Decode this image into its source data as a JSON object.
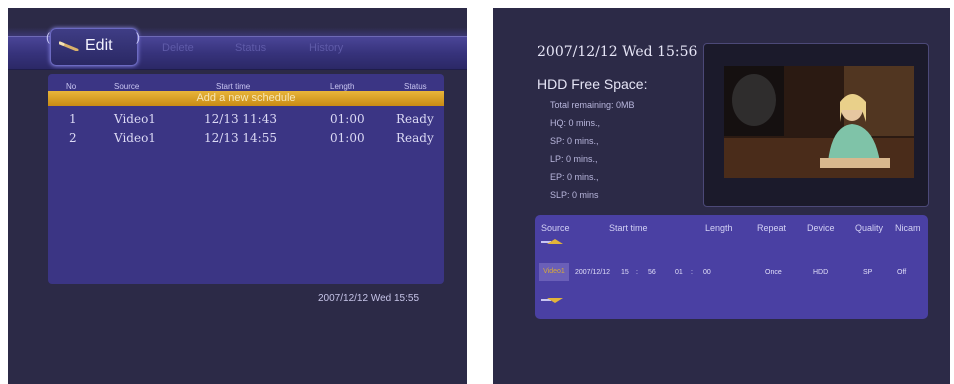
{
  "left": {
    "tabs": {
      "edit": "Edit",
      "delete": "Delete",
      "status": "Status",
      "history": "History"
    },
    "table": {
      "headers": [
        "No",
        "Source",
        "Start time",
        "Length",
        "Status"
      ],
      "add_new": "Add a new schedule",
      "rows": [
        {
          "no": "1",
          "source": "Video1",
          "start": "12/13 11:43",
          "length": "01:00",
          "status": "Ready"
        },
        {
          "no": "2",
          "source": "Video1",
          "start": "12/13 14:55",
          "length": "01:00",
          "status": "Ready"
        }
      ]
    },
    "datetime": "2007/12/12 Wed 15:55"
  },
  "right": {
    "datetime": "2007/12/12 Wed 15:56",
    "hdd_title": "HDD Free Space:",
    "hdd_lines": [
      "Total remaining: 0MB",
      "HQ: 0 mins.,",
      "SP: 0 mins.,",
      "LP: 0 mins.,",
      "EP: 0 mins.,",
      "SLP: 0 mins"
    ],
    "schedule": {
      "headers": [
        "Source",
        "Start time",
        "Length",
        "Repeat",
        "Device",
        "Quality",
        "Nicam"
      ],
      "values": {
        "source": "Video1",
        "date": "2007/12/12",
        "hour": "15",
        "colon1": ":",
        "minute": "56",
        "len_h": "01",
        "colon2": ":",
        "len_m": "00",
        "repeat": "Once",
        "device": "HDD",
        "quality": "SP",
        "nicam": "Off"
      }
    }
  },
  "colors": {
    "background": "#2c2a47",
    "panel": "#3b3584",
    "highlight": "#e0a82e",
    "schedule_panel": "#4a40a3"
  }
}
